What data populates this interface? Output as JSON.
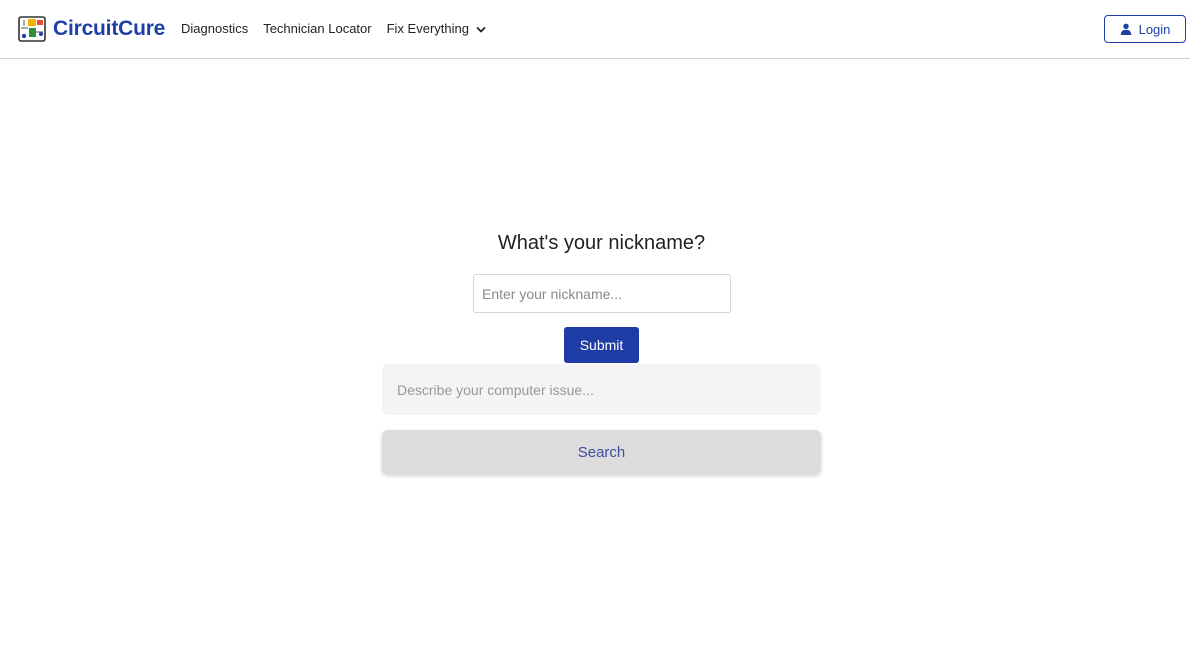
{
  "header": {
    "brand_name": "CircuitCure",
    "brand_color": "#1d3fa8",
    "logo_icon": "circuit-board-icon",
    "nav": [
      {
        "label": "Diagnostics"
      },
      {
        "label": "Technician Locator"
      },
      {
        "label": "Fix Everything",
        "dropdown": true
      }
    ],
    "login_label": "Login",
    "login_icon": "user-icon"
  },
  "main": {
    "title": "What's your nickname?",
    "nickname_placeholder": "Enter your nickname...",
    "nickname_value": "",
    "submit_label": "Submit",
    "submit_color": "#1e3ba6",
    "issue_placeholder": "Describe your computer issue...",
    "issue_value": "",
    "search_label": "Search"
  }
}
